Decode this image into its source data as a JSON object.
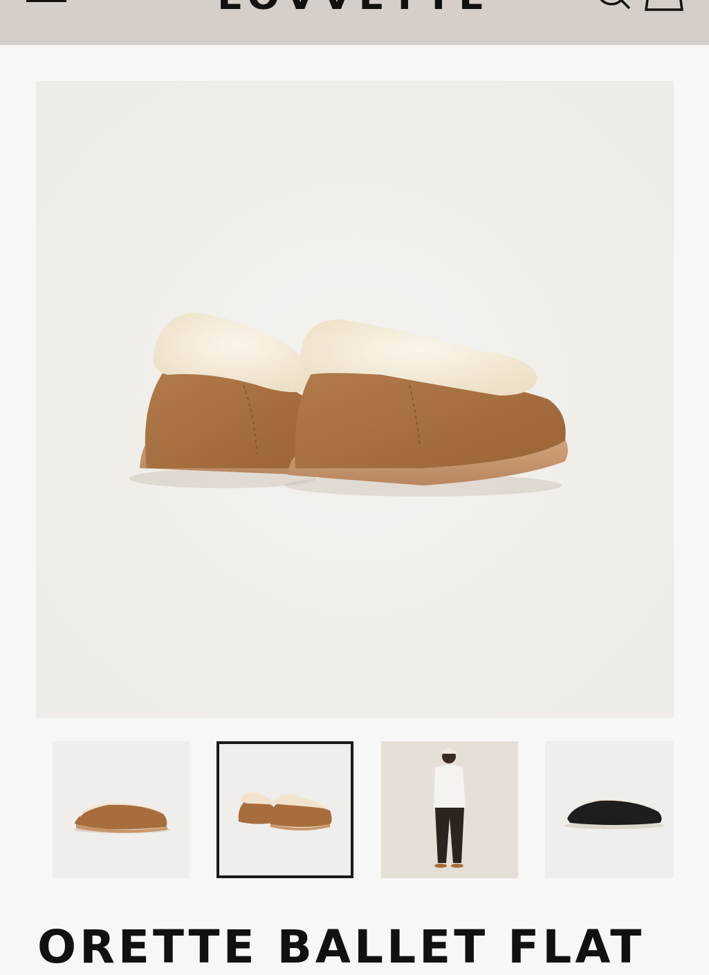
{
  "header": {
    "logo": "LOVVETTE",
    "menu_icon": "hamburger-menu-icon",
    "search_icon": "search-icon",
    "cart_icon": "shopping-bag-icon",
    "background": "#d6cfc9"
  },
  "gallery": {
    "main_image_alt": "Ballet flat, chestnut suede with shearling collar, rear view",
    "zoom_icon": "zoom-magnifier-icon",
    "thumbnails": [
      {
        "alt": "Chestnut ballet flat side view",
        "active": false
      },
      {
        "alt": "Chestnut ballet flat pair rear view",
        "active": true
      },
      {
        "alt": "Model wearing ballet flats",
        "active": false
      },
      {
        "alt": "Black ballet flat side view",
        "active": false
      }
    ]
  },
  "product": {
    "title": "ORETTE BALLET FLAT"
  }
}
